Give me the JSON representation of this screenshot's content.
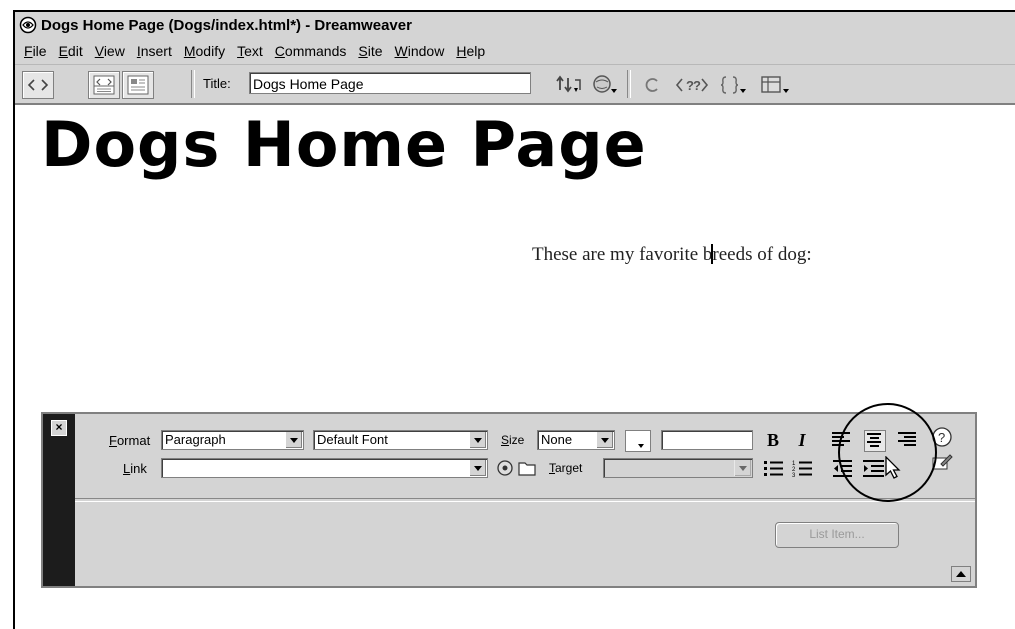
{
  "window": {
    "title": "Dogs Home Page (Dogs/index.html*) - Dreamweaver"
  },
  "menu": [
    "File",
    "Edit",
    "View",
    "Insert",
    "Modify",
    "Text",
    "Commands",
    "Site",
    "Window",
    "Help"
  ],
  "toolbar": {
    "title_label": "Title:",
    "title_value": "Dogs Home Page"
  },
  "document": {
    "heading": "Dogs Home Page",
    "paragraph_before": "These are my favorite b",
    "paragraph_after": "reeds of dog:"
  },
  "inspector": {
    "format_label": "Format",
    "format_value": "Paragraph",
    "font_value": "Default Font",
    "size_label": "Size",
    "size_value": "None",
    "link_label": "Link",
    "link_value": "",
    "target_label": "Target",
    "target_value": "",
    "bold": "B",
    "italic": "I",
    "list_item_button": "List Item..."
  },
  "icons": {
    "app": "dreamweaver-icon",
    "code_view": "code-view-icon",
    "split_view": "split-view-icon",
    "design_view": "design-view-icon",
    "file_management": "file-management-icon",
    "preview": "preview-browser-icon",
    "refresh": "refresh-icon",
    "code_nav": "code-navigation-icon",
    "options": "view-options-icon"
  }
}
